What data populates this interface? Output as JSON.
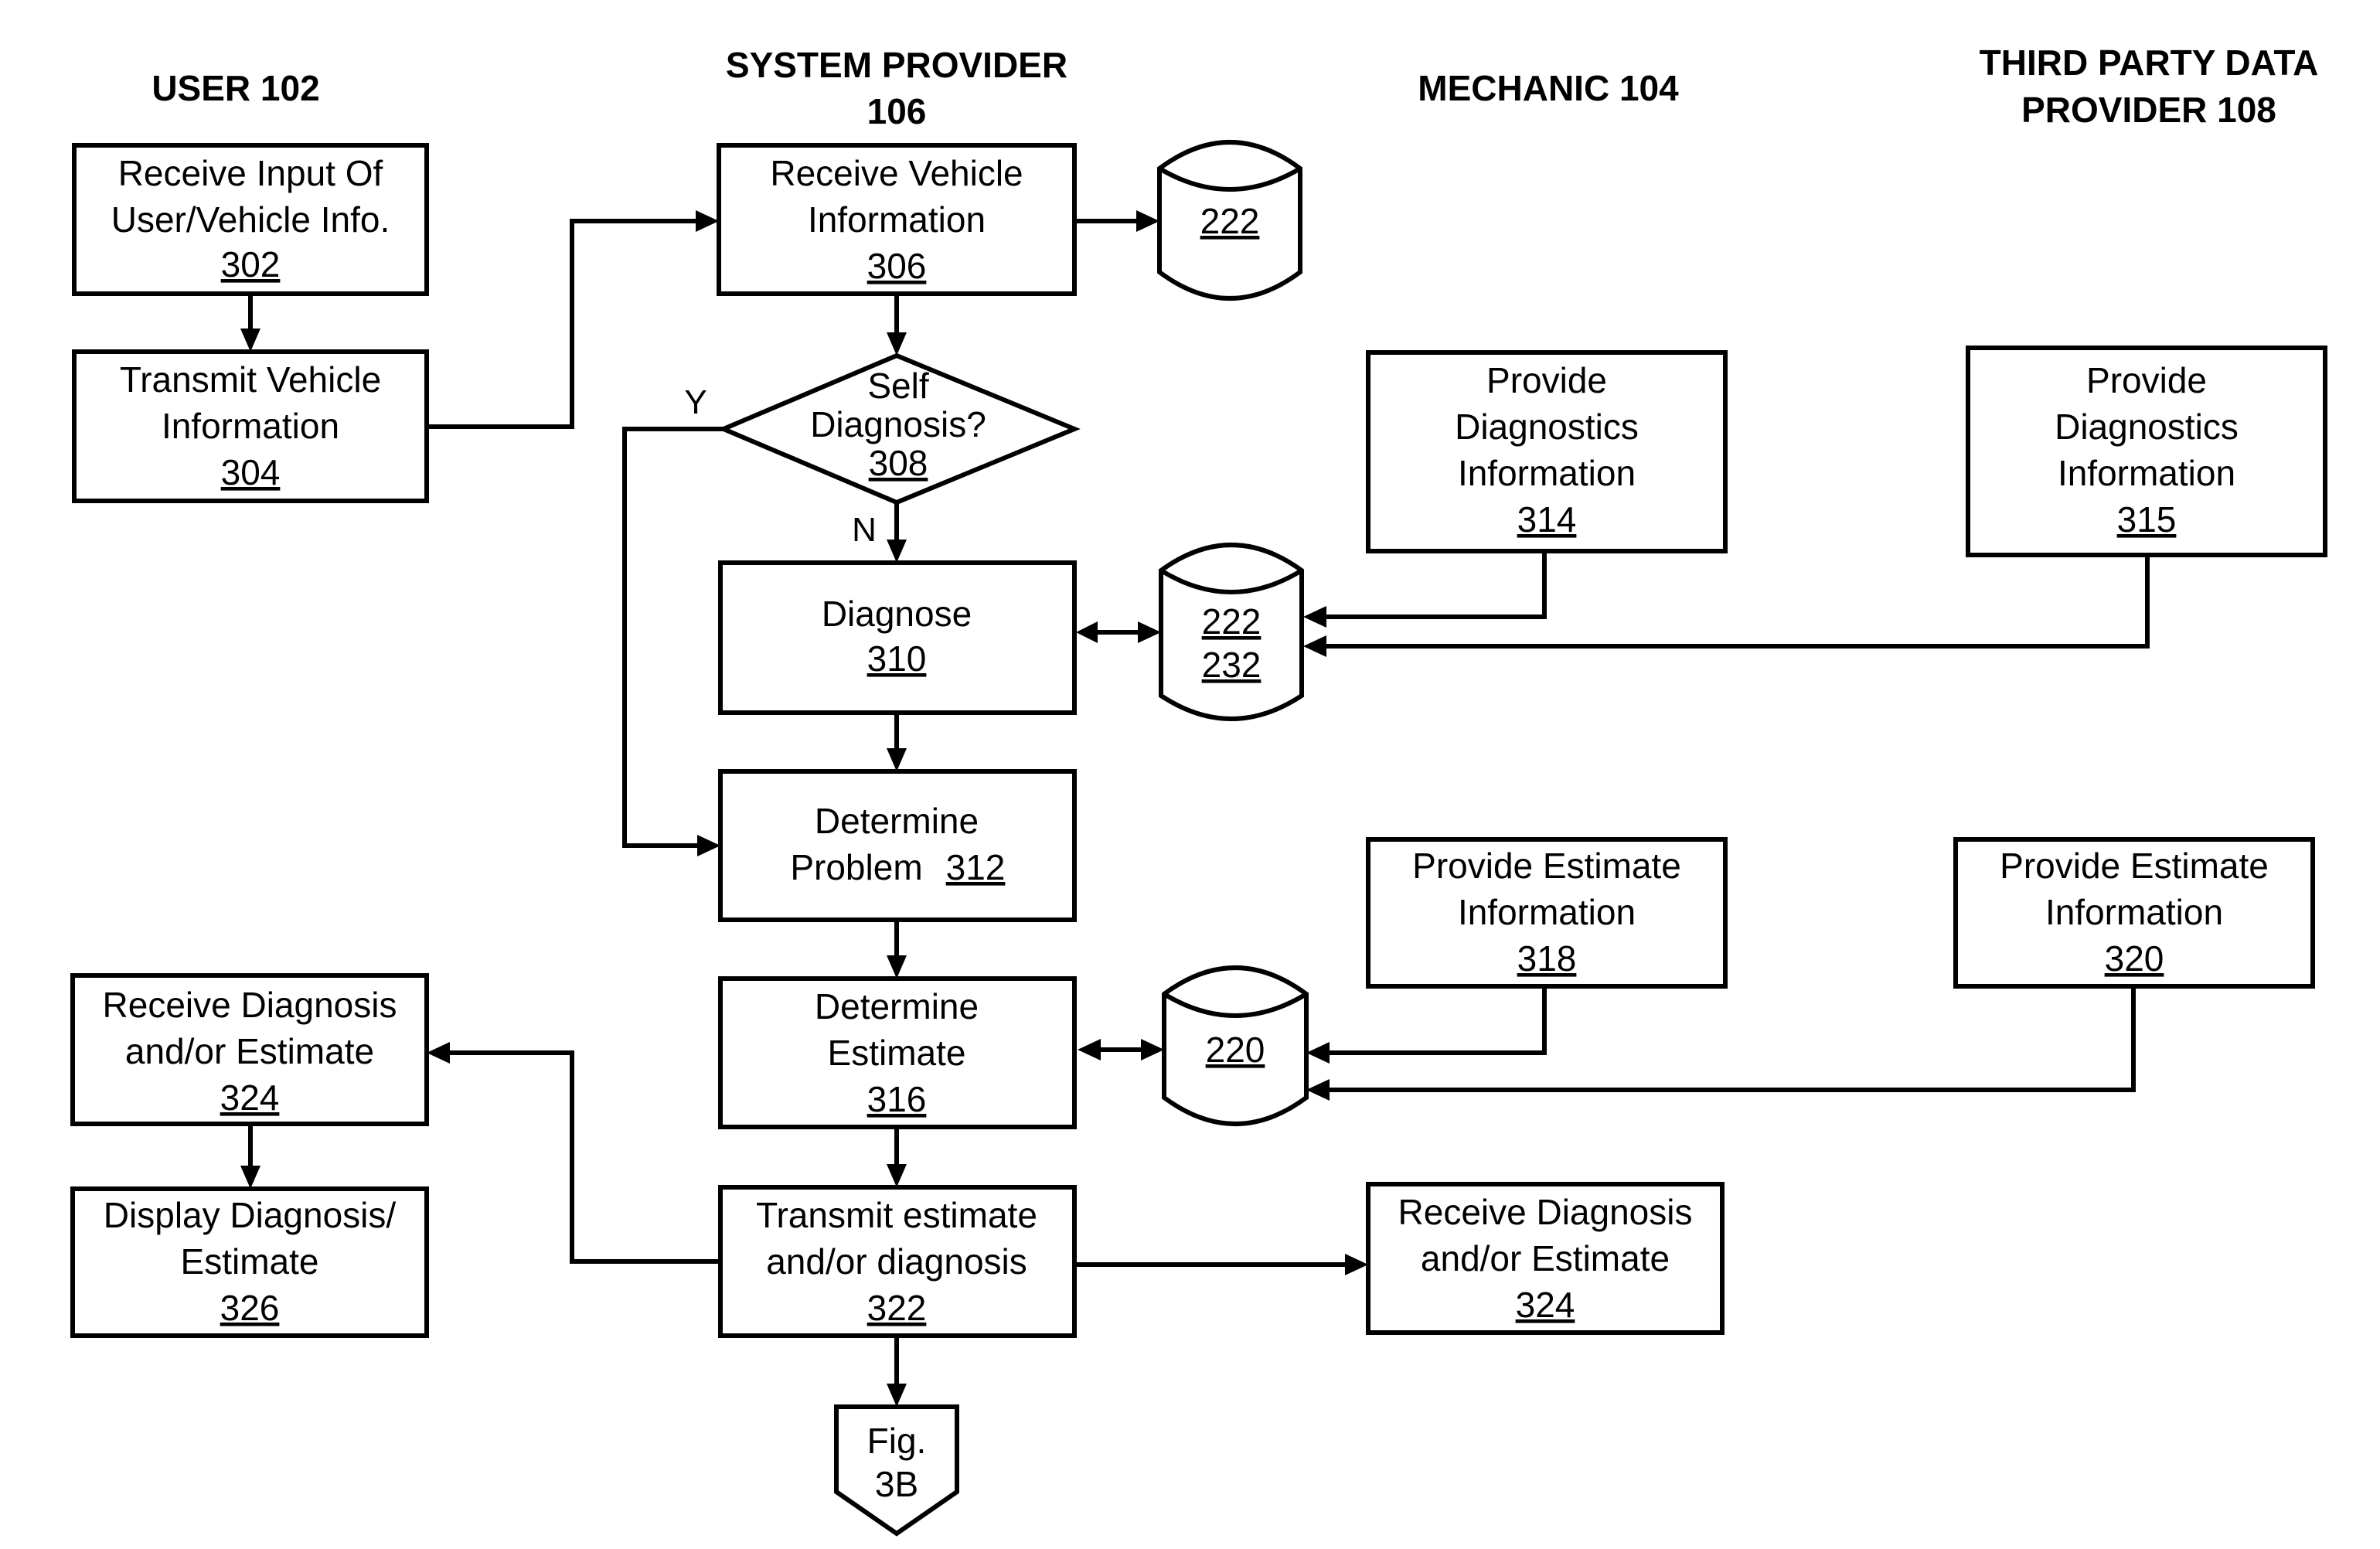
{
  "lanes": {
    "user": "USER 102",
    "system_provider_line1": "SYSTEM PROVIDER",
    "system_provider_line2": "106",
    "mechanic": "MECHANIC 104",
    "third_party_line1": "THIRD PARTY DATA",
    "third_party_line2": "PROVIDER 108"
  },
  "steps": {
    "s302": {
      "line1": "Receive Input Of",
      "line2": "User/Vehicle Info.",
      "ref": "302"
    },
    "s304": {
      "line1": "Transmit Vehicle",
      "line2": "Information",
      "ref": "304"
    },
    "s306": {
      "line1": "Receive Vehicle",
      "line2": "Information",
      "ref": "306"
    },
    "s308": {
      "line1": "Self",
      "line2": "Diagnosis?",
      "ref": "308",
      "yes": "Y",
      "no": "N"
    },
    "s310": {
      "line1": "Diagnose",
      "ref": "310"
    },
    "s312": {
      "line1": "Determine",
      "line2": "Problem",
      "ref": "312"
    },
    "s314": {
      "line1": "Provide",
      "line2": "Diagnostics",
      "line3": "Information",
      "ref": "314"
    },
    "s315": {
      "line1": "Provide",
      "line2": "Diagnostics",
      "line3": "Information",
      "ref": "315"
    },
    "s316": {
      "line1": "Determine",
      "line2": "Estimate",
      "ref": "316"
    },
    "s318": {
      "line1": "Provide Estimate",
      "line2": "Information",
      "ref": "318"
    },
    "s320": {
      "line1": "Provide Estimate",
      "line2": "Information",
      "ref": "320"
    },
    "s322": {
      "line1": "Transmit estimate",
      "line2": "and/or diagnosis",
      "ref": "322"
    },
    "s324_user": {
      "line1": "Receive Diagnosis",
      "line2": "and/or Estimate",
      "ref": "324"
    },
    "s324_mech": {
      "line1": "Receive Diagnosis",
      "line2": "and/or Estimate",
      "ref": "324"
    },
    "s326": {
      "line1": "Display Diagnosis/",
      "line2": "Estimate",
      "ref": "326"
    }
  },
  "databases": {
    "db_top": {
      "ref": "222"
    },
    "db_diag": {
      "ref1": "222",
      "ref2": "232"
    },
    "db_est": {
      "ref": "220"
    }
  },
  "offpage": {
    "line1": "Fig.",
    "line2": "3B"
  }
}
